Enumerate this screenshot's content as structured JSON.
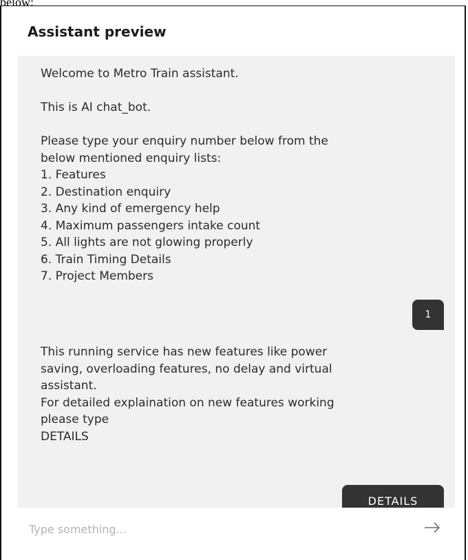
{
  "doc_fragment": "below:",
  "header": {
    "title": "Assistant preview"
  },
  "messages": {
    "bot_1": "Welcome to Metro Train assistant.",
    "bot_2": "This is AI chat_bot.",
    "bot_3": "Please type your enquiry number below from the\nbelow mentioned enquiry lists:\n1. Features\n2. Destination enquiry\n3. Any kind of emergency help\n4. Maximum passengers intake count\n5. All lights are not glowing properly\n6. Train Timing Details\n7. Project Members",
    "user_1": "1",
    "bot_4": "This running service has new features like power\nsaving, overloading features, no delay and virtual\nassistant.\nFor detailed explaination on new features working\nplease type\nDETAILS",
    "user_2": "DETAILS"
  },
  "input": {
    "placeholder": "Type something..."
  },
  "icons": {
    "send": "arrow-right-icon"
  },
  "colors": {
    "chat_background": "#f1f1f1",
    "user_bubble": "#333333",
    "placeholder": "#b3b3b3"
  }
}
